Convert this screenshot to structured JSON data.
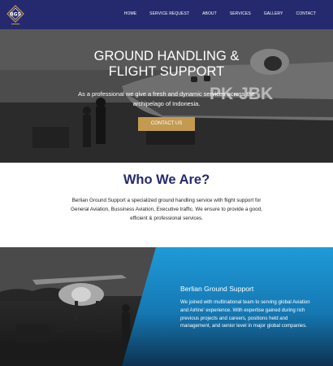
{
  "nav": {
    "logo_text": "BGS",
    "links": [
      "HOME",
      "SERVICE REQUEST",
      "ABOUT",
      "SERVICES",
      "GALLERY",
      "CONTACT"
    ]
  },
  "hero": {
    "title_line1": "GROUND HANDLING &",
    "title_line2": "FLIGHT SUPPORT",
    "subtitle": "As a professional we give a fresh and dynamic services across the archipelago of Indonesia.",
    "button_label": "CONTACT US",
    "aircraft_registration": "PK-JBK"
  },
  "who": {
    "title": "Who We Are?",
    "text": "Berlian Ground Support a specialized ground handling service with flight support for General Aviation, Bussiness Aviation, Executive traffic. We ensure to provide a good, efficient & professional services."
  },
  "about": {
    "title": "Berlian Ground Support",
    "text": "We joined with multinational team to serving global Aviation and Airline' experience. With expertise gained during rich previous projects and careers, positions held and management, and senior level in major global companies."
  },
  "colors": {
    "navy": "#252a6e",
    "gold": "#c49a52",
    "blue": "#1f8fd0"
  }
}
